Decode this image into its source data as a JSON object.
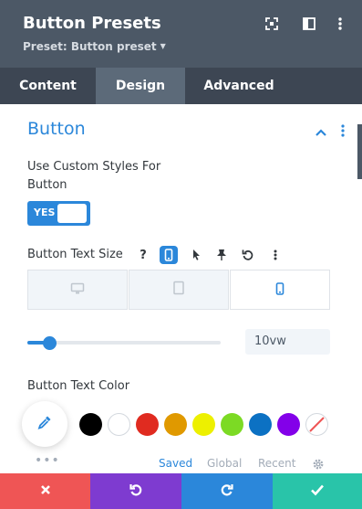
{
  "header": {
    "title": "Button Presets",
    "preset_label": "Preset: Button preset",
    "background": "#4c5866"
  },
  "tabs": [
    {
      "label": "Content",
      "active": false
    },
    {
      "label": "Design",
      "active": true
    },
    {
      "label": "Advanced",
      "active": false
    }
  ],
  "section": {
    "title": "Button",
    "accent": "#2b87da"
  },
  "custom_styles": {
    "label_line1": "Use Custom Styles For",
    "label_line2": "Button",
    "toggle_label": "YES",
    "enabled": true
  },
  "text_size": {
    "label": "Button Text Size",
    "help_icon": "question-icon",
    "value": "10vw",
    "slider_fraction": 0.12,
    "active_device": "phone"
  },
  "text_color": {
    "label": "Button Text Color",
    "swatches": [
      "#000000",
      "#ffffff",
      "#e02b20",
      "#e09900",
      "#edf000",
      "#7cda24",
      "#0c71c3",
      "#8300e9",
      "none"
    ],
    "palette_tabs": [
      {
        "label": "Saved",
        "active": true
      },
      {
        "label": "Global",
        "active": false
      },
      {
        "label": "Recent",
        "active": false
      }
    ]
  },
  "footer": {
    "colors": {
      "cancel": "#ef5555",
      "undo": "#7e3bd0",
      "redo": "#2b87da",
      "save": "#29c4a9"
    }
  }
}
